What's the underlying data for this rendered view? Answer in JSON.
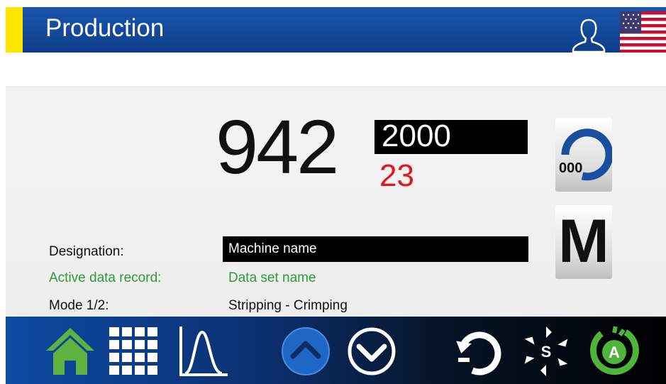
{
  "header": {
    "title": "Production",
    "accent_color": "#ffe500",
    "user_icon": "user-icon",
    "language_icon": "us-flag-icon"
  },
  "counter": {
    "actual": "942",
    "target": "2000",
    "remaining": "23",
    "remaining_color": "#e8141e",
    "counter_button_text": "000"
  },
  "manual_button": {
    "label": "M"
  },
  "fields": {
    "designation_label": "Designation:",
    "designation_value": "Machine name",
    "active_record_label": "Active data record:",
    "active_record_value": "Data set name",
    "mode_label": "Mode 1/2:",
    "mode_value": "Stripping - Crimping"
  },
  "footer": {
    "icons": [
      "home-icon",
      "grid-icon",
      "graph-icon",
      "scroll-up-icon",
      "scroll-down-icon",
      "reset-cycle-icon",
      "single-cycle-icon",
      "auto-cycle-icon"
    ]
  }
}
